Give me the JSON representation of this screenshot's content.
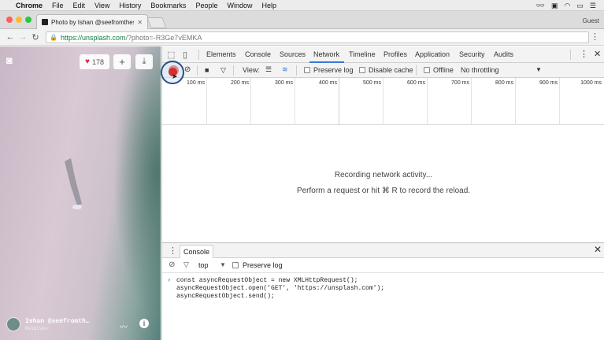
{
  "menubar": {
    "app": "Chrome",
    "items": [
      "File",
      "Edit",
      "View",
      "History",
      "Bookmarks",
      "People",
      "Window",
      "Help"
    ]
  },
  "browser": {
    "tab_title": "Photo by Ishan @seefromthes",
    "profile": "Guest",
    "url_host": "https://unsplash.com",
    "url_path": "/?photo=-R3Ge7vEMKA"
  },
  "photo": {
    "likes": "178",
    "author_name": "Ishan @seefromth…",
    "author_location": "Maldives"
  },
  "devtools": {
    "tabs": [
      "Elements",
      "Console",
      "Sources",
      "Network",
      "Timeline",
      "Profiles",
      "Application",
      "Security",
      "Audits"
    ],
    "active_tab": "Network",
    "toolbar": {
      "view_label": "View:",
      "preserve_log": "Preserve log",
      "disable_cache": "Disable cache",
      "offline": "Offline",
      "throttling": "No throttling"
    },
    "timeline_ticks": [
      "100 ms",
      "200 ms",
      "300 ms",
      "400 ms",
      "500 ms",
      "600 ms",
      "700 ms",
      "800 ms",
      "900 ms",
      "1000 ms"
    ],
    "empty_state": {
      "line1": "Recording network activity...",
      "line2": "Perform a request or hit ⌘ R to record the reload."
    },
    "drawer": {
      "tab": "Console",
      "context": "top",
      "preserve_log": "Preserve log",
      "code": [
        "const asyncRequestObject = new XMLHttpRequest();",
        "asyncRequestObject.open('GET', 'https://unsplash.com');",
        "asyncRequestObject.send();"
      ]
    }
  }
}
